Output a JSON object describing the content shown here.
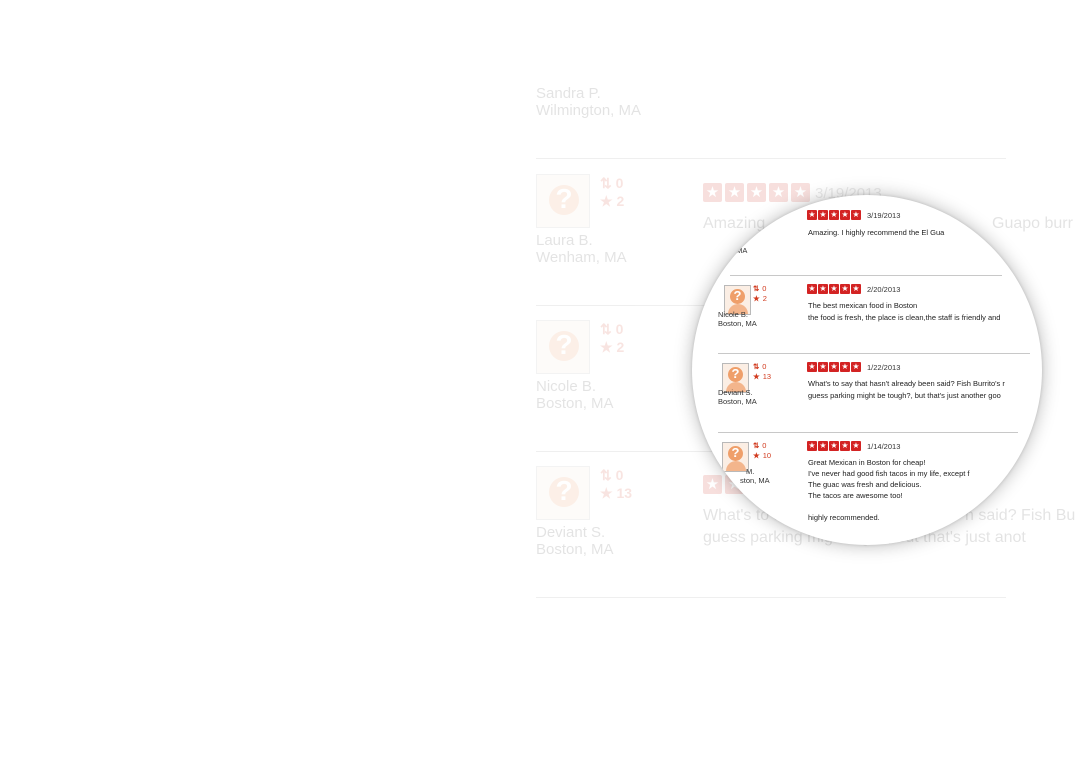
{
  "background": {
    "top_reviewer": {
      "name": "Sandra P.",
      "location": "Wilmington, MA"
    },
    "reviews": [
      {
        "name": "Laura B.",
        "location": "Wenham, MA",
        "friends": "0",
        "reviews": "2",
        "date": "3/19/2013",
        "text": [
          "Amazing.",
          "Guapo burr"
        ]
      },
      {
        "name": "Nicole B.",
        "location": "Boston, MA",
        "friends": "0",
        "reviews": "2"
      },
      {
        "name": "Deviant S.",
        "location": "Boston, MA",
        "friends": "0",
        "reviews": "13",
        "text": [
          "What's to s",
          "n said? Fish Bu",
          "guess parking mig",
          "ugh?, but that's just anot"
        ]
      }
    ]
  },
  "magnifier": {
    "top": {
      "location": ", MA",
      "date": "3/19/2013",
      "text": [
        "Amazing. I highly recommend the El Gua"
      ]
    },
    "reviews": [
      {
        "name": "Nicole B.",
        "location": "Boston, MA",
        "friends": "0",
        "reviews": "2",
        "date": "2/20/2013",
        "text": [
          "The best mexican food in Boston",
          "the food is fresh, the place is clean,the staff is friendly and"
        ]
      },
      {
        "name": "Deviant S.",
        "location": "Boston, MA",
        "friends": "0",
        "reviews": "13",
        "date": "1/22/2013",
        "text": [
          "What's to say that hasn't already been said? Fish Burrito's r",
          "guess parking might be tough?, but that's just another goo"
        ]
      },
      {
        "name": "M.",
        "location": "ston, MA",
        "friends": "0",
        "reviews": "10",
        "date": "1/14/2013",
        "text": [
          "Great Mexican in Boston for cheap!",
          "I've never had good fish tacos in my life, except f",
          "The guac was fresh and delicious.",
          "The tacos are awesome too!",
          "",
          "highly recommended."
        ]
      }
    ]
  },
  "icons": {
    "friends": "friends-icon",
    "review": "star-icon"
  },
  "colors": {
    "star_red": "#d32323",
    "stat_orange": "#d13a1e"
  }
}
